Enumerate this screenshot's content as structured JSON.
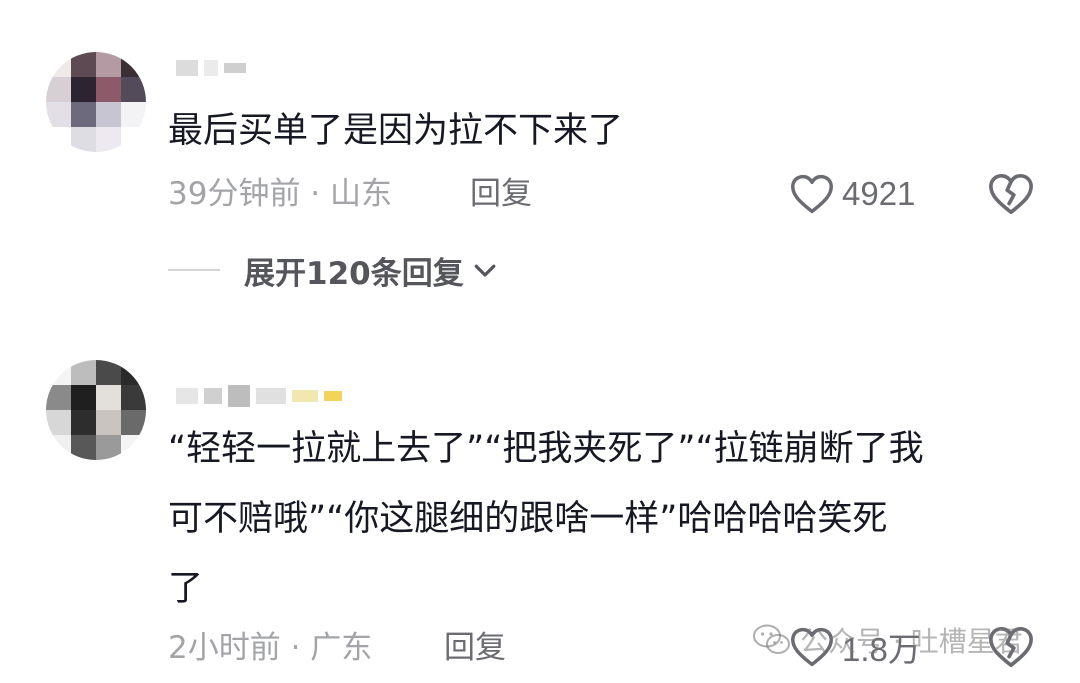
{
  "comments": [
    {
      "text": "最后买单了是因为拉不下来了",
      "time_location": "39分钟前 · 山东",
      "reply_label": "回复",
      "like_count": "4921",
      "expand_label": "展开120条回复"
    },
    {
      "text": "“轻轻一拉就上去了”“把我夹死了”“拉链崩断了我\n可不赔哦”“你这腿细的跟啥一样”哈哈哈哈笑死\n了",
      "time_location": "2小时前 · 广东",
      "reply_label": "回复",
      "like_count": "1.8万"
    }
  ],
  "watermark": {
    "text": "公众号 · 吐槽星君",
    "icon": "wechat-icon"
  },
  "icons": {
    "like": "heart-outline-icon",
    "dislike": "broken-heart-icon",
    "expand": "chevron-down-icon"
  },
  "colors": {
    "text_primary": "#161823",
    "text_meta": "#a3a4a8",
    "icon_gray": "#6b6c72"
  }
}
